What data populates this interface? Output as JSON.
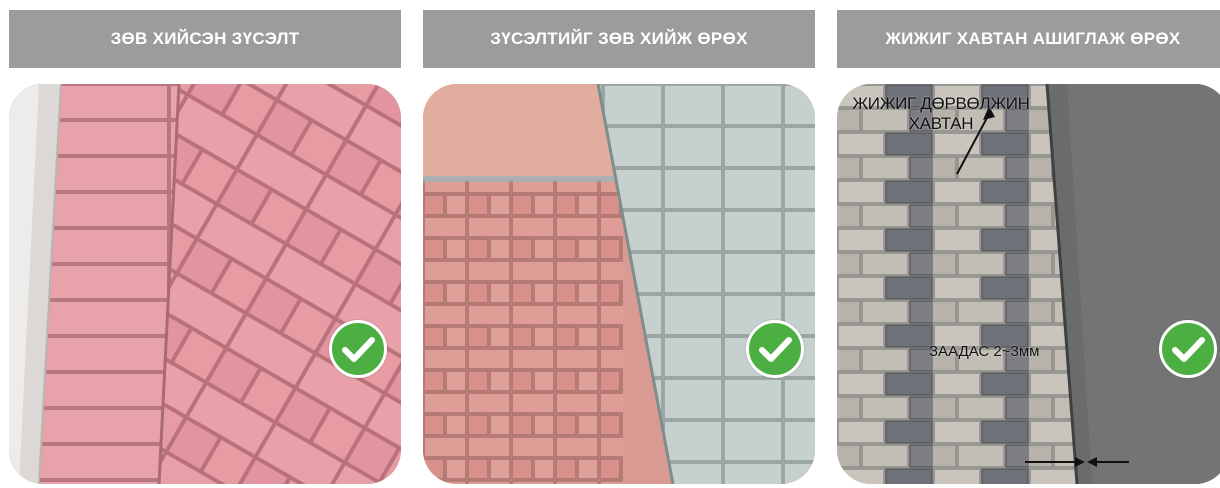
{
  "panels": [
    {
      "title": "ЗӨВ ХИЙСЭН ЗҮСЭЛТ",
      "icon": "check-circle-icon",
      "status_color": "#4caf42"
    },
    {
      "title": "ЗҮСЭЛТИЙГ ЗӨВ ХИЙЖ ӨРӨХ",
      "icon": "check-circle-icon",
      "status_color": "#4caf42"
    },
    {
      "title": "ЖИЖИГ ХАВТАН АШИГЛАЖ ӨРӨХ",
      "icon": "check-circle-icon",
      "status_color": "#4caf42",
      "annotations": {
        "small_tile_line1": "ЖИЖИГ ДӨРВӨЛЖИН",
        "small_tile_line2": "ХАВТАН",
        "gap_label": "ЗААДАС 2~3мм"
      }
    }
  ],
  "colors": {
    "header_bg": "#9c9c9c",
    "header_text": "#ffffff",
    "pink_paver": "#e3989f",
    "gray_paver_dark": "#6f7075",
    "gray_paver_light": "#c4c0b6"
  }
}
